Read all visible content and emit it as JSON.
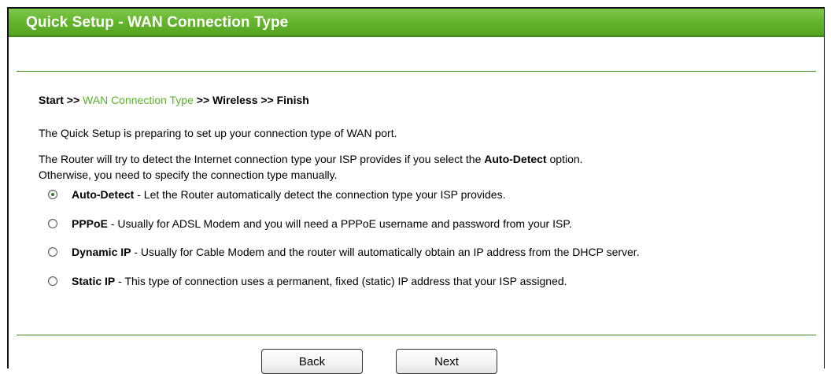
{
  "header": {
    "title": "Quick Setup - WAN Connection Type"
  },
  "breadcrumb": {
    "start": "Start >>",
    "current": "WAN Connection Type",
    "rest": ">> Wireless >> Finish"
  },
  "intro": "The Quick Setup is preparing to set up your connection type of WAN port.",
  "detect_text": {
    "before": "The Router will try to detect the Internet connection type your ISP provides if you select the",
    "bold": "Auto-Detect",
    "after": "option.",
    "line2": "Otherwise, you need to specify the connection type manually."
  },
  "options": [
    {
      "name": "Auto-Detect",
      "desc": " - Let the Router automatically detect the connection type your ISP provides.",
      "checked": true
    },
    {
      "name": "PPPoE",
      "desc": " - Usually for ADSL Modem and you will need a PPPoE username and password from your ISP.",
      "checked": false
    },
    {
      "name": "Dynamic IP",
      "desc": " - Usually for Cable Modem and the router will automatically obtain an IP address from the DHCP server.",
      "checked": false
    },
    {
      "name": "Static IP",
      "desc": " - This type of connection uses a permanent, fixed (static) IP address that your ISP assigned.",
      "checked": false
    }
  ],
  "buttons": {
    "back": "Back",
    "next": "Next"
  },
  "colors": {
    "header_green": "#62b22c",
    "active_link": "#5bb12a"
  }
}
